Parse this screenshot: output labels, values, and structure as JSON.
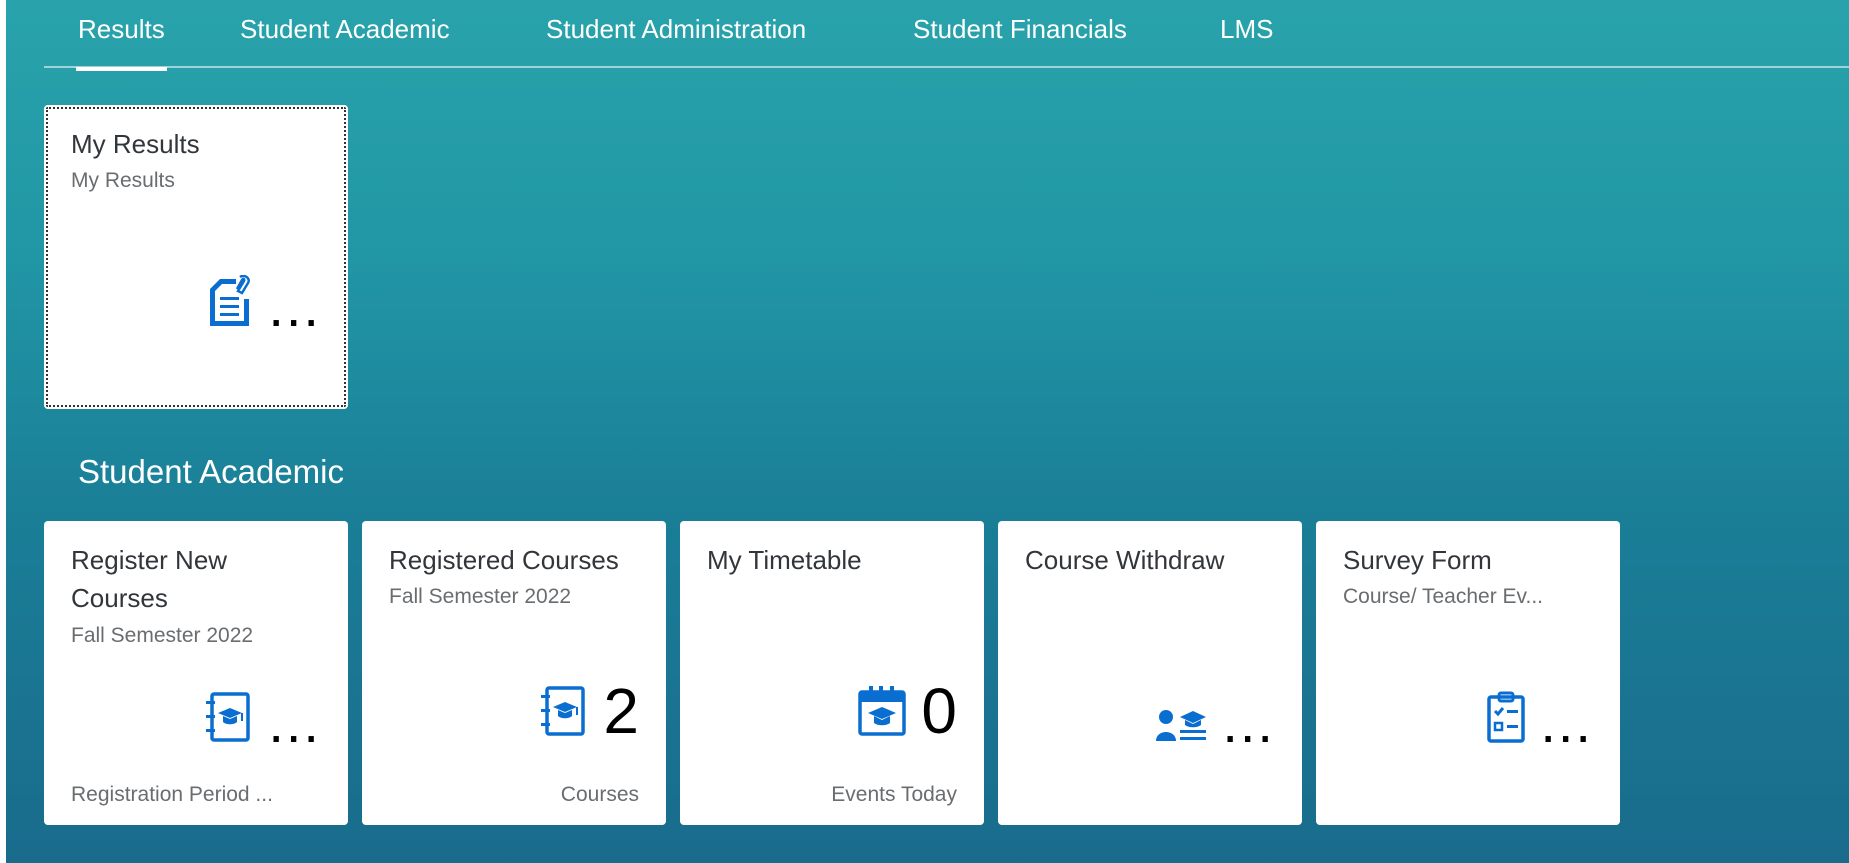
{
  "tabs": [
    {
      "label": "Results",
      "active": true
    },
    {
      "label": "Student Academic"
    },
    {
      "label": "Student Administration"
    },
    {
      "label": "Student Financials"
    },
    {
      "label": "LMS"
    }
  ],
  "results_group": {
    "tiles": [
      {
        "title": "My Results",
        "subtitle": "My Results",
        "kpi": "...",
        "icon": "document-edit-icon"
      }
    ]
  },
  "academic_group": {
    "heading": "Student Academic",
    "tiles": [
      {
        "title": "Register New Courses",
        "subtitle": "Fall Semester 2022",
        "kpi": "...",
        "footer": "Registration Period ...",
        "icon": "course-book-icon"
      },
      {
        "title": "Registered Courses",
        "subtitle": "Fall Semester 2022",
        "kpi": "2",
        "footer": "Courses",
        "icon": "course-book-icon"
      },
      {
        "title": "My Timetable",
        "subtitle": "",
        "kpi": "0",
        "footer": "Events Today",
        "icon": "calendar-icon"
      },
      {
        "title": "Course Withdraw",
        "subtitle": "",
        "kpi": "...",
        "footer": "",
        "icon": "student-course-icon"
      },
      {
        "title": "Survey Form",
        "subtitle": "Course/ Teacher Ev...",
        "kpi": "...",
        "footer": "",
        "icon": "survey-checklist-icon"
      }
    ]
  },
  "colors": {
    "icon_blue": "#0a6ed1",
    "tile_bg": "#ffffff",
    "bg_top": "#29a3ab",
    "bg_bottom": "#196b8c"
  }
}
